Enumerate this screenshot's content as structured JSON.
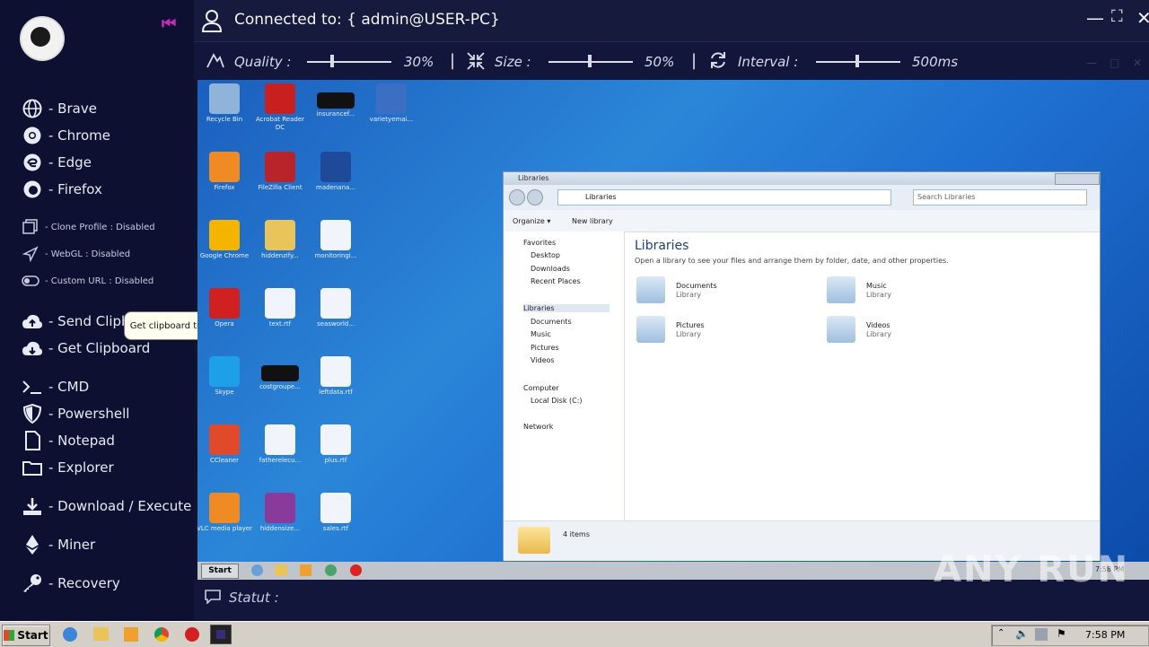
{
  "header": {
    "title": "Connected to: { admin@USER-PC}",
    "minimize": "—",
    "maximize": "⛶",
    "close": "✕"
  },
  "toolbar": {
    "quality_label": "Quality :",
    "quality_value": "30%",
    "size_label": "Size :",
    "size_value": "50%",
    "interval_label": "Interval :",
    "interval_value": "500ms",
    "separator": "|",
    "sub_minimize": "—",
    "sub_maximize": "□",
    "sub_close": "✕"
  },
  "sidebar": {
    "items": [
      {
        "label": "- Brave",
        "icon": "globe-icon"
      },
      {
        "label": "- Chrome",
        "icon": "chrome-icon"
      },
      {
        "label": "- Edge",
        "icon": "edge-icon"
      },
      {
        "label": "- Firefox",
        "icon": "firefox-icon"
      },
      {
        "label": "- Clone Profile : Disabled",
        "icon": "copy-icon"
      },
      {
        "label": "- WebGL : Disabled",
        "icon": "send-icon"
      },
      {
        "label": "- Custom URL : Disabled",
        "icon": "toggle-icon"
      },
      {
        "label": "- Send Clipbo",
        "icon": "cloud-upload-icon"
      },
      {
        "label": "- Get Clipboard",
        "icon": "cloud-download-icon"
      },
      {
        "label": "- CMD",
        "icon": "terminal-icon"
      },
      {
        "label": "- Powershell",
        "icon": "shield-icon"
      },
      {
        "label": "- Notepad",
        "icon": "file-icon"
      },
      {
        "label": "- Explorer",
        "icon": "folder-icon"
      },
      {
        "label": "- Download / Execute",
        "icon": "download-icon"
      },
      {
        "label": "- Miner",
        "icon": "ethereum-icon"
      },
      {
        "label": "- Recovery",
        "icon": "key-icon"
      }
    ]
  },
  "tooltip": "Get clipboard text from victim",
  "statut": {
    "label": "Statut :"
  },
  "remote": {
    "desktop_icons": [
      {
        "cap": "Recycle Bin"
      },
      {
        "cap": "Acrobat Reader DC"
      },
      {
        "cap": "insurancef..."
      },
      {
        "cap": "varietyemai..."
      },
      {
        "cap": "Firefox"
      },
      {
        "cap": "FileZilla Client"
      },
      {
        "cap": "madenana..."
      },
      {
        "cap": "Google Chrome"
      },
      {
        "cap": "hiddenzify..."
      },
      {
        "cap": "monitoringi..."
      },
      {
        "cap": "Opera"
      },
      {
        "cap": "text.rtf"
      },
      {
        "cap": "seasworld..."
      },
      {
        "cap": "Skype"
      },
      {
        "cap": "costgroupe..."
      },
      {
        "cap": "leftdata.rtf"
      },
      {
        "cap": "CCleaner"
      },
      {
        "cap": "fatherelecu..."
      },
      {
        "cap": "plus.rtf"
      },
      {
        "cap": "VLC media player"
      },
      {
        "cap": "hiddensize..."
      },
      {
        "cap": "sales.rtf"
      }
    ],
    "explorer": {
      "title": "Libraries",
      "breadcrumb": "Libraries",
      "search_placeholder": "Search Libraries",
      "organize": "Organize ▾",
      "new_library": "New library",
      "heading": "Libraries",
      "subtitle": "Open a library to see your files and arrange them by folder, date, and other properties.",
      "nav": [
        "Favorites",
        "Desktop",
        "Downloads",
        "Recent Places",
        "Libraries",
        "Documents",
        "Music",
        "Pictures",
        "Videos",
        "Computer",
        "Local Disk (C:)",
        "Network"
      ],
      "libs": [
        {
          "name": "Documents",
          "type": "Library"
        },
        {
          "name": "Music",
          "type": "Library"
        },
        {
          "name": "Pictures",
          "type": "Library"
        },
        {
          "name": "Videos",
          "type": "Library"
        }
      ],
      "status": "4 items"
    },
    "taskbar": {
      "start": "Start",
      "clock": "7:58 PM"
    }
  },
  "host_taskbar": {
    "start": "Start",
    "clock": "7:58 PM"
  },
  "watermark": "ANY RUN",
  "colors": {
    "sidebar_bg": "#0d1030",
    "accent": "#c02cb8",
    "header_bg": "#161a3c"
  }
}
